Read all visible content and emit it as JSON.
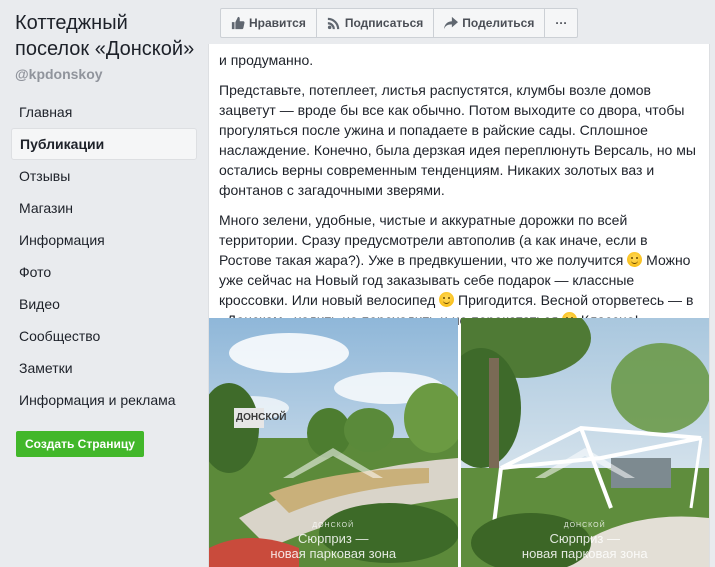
{
  "page": {
    "title": "Коттеджный поселок «Донской»",
    "handle": "@kpdonskoy"
  },
  "nav": {
    "items": [
      "Главная",
      "Публикации",
      "Отзывы",
      "Магазин",
      "Информация",
      "Фото",
      "Видео",
      "Сообщество",
      "Заметки",
      "Информация и реклама"
    ],
    "active_index": 1
  },
  "create_page_label": "Создать Страницу",
  "actions": {
    "like": "Нравится",
    "follow": "Подписаться",
    "share": "Поделиться",
    "more": "···"
  },
  "post": {
    "para0": "и продуманно.",
    "para1": "Представьте, потеплеет, листья распустятся, клумбы возле домов зацветут — вроде бы все как обычно. Потом выходите со двора, чтобы прогуляться после ужина и попадаете в райские сады. Сплошное наслаждение. Конечно, была дерзкая идея переплюнуть Версаль, но мы остались верны современным тенденциям. Никаких золотых ваз и фонтанов с загадочными зверями.",
    "para2_a": "Много зелени, удобные, чистые и аккуратные дорожки по всей территории. Сразу предусмотрели автополив (а как иначе, если в Ростове такая жара?). Уже в предвкушении, что же получится ",
    "para2_b": " Можно уже сейчас на Новый год заказывать себе подарок — классные кроссовки. Или новый велосипед ",
    "para2_c": " Пригодится. Весной оторветесь — в «Донском» ходить не переходить и не перекататься ",
    "para2_d": " Классно!"
  },
  "photos": [
    {
      "caption_line1": "Сюрприз —",
      "caption_line2": "новая парковая зона",
      "sign": "ДОНСКОЙ",
      "brand": "ДОНСКОЙ"
    },
    {
      "caption_line1": "Сюрприз —",
      "caption_line2": "новая парковая зона",
      "brand": "ДОНСКОЙ"
    }
  ],
  "colors": {
    "accent_green": "#42b72a",
    "background": "#e9ebee"
  }
}
